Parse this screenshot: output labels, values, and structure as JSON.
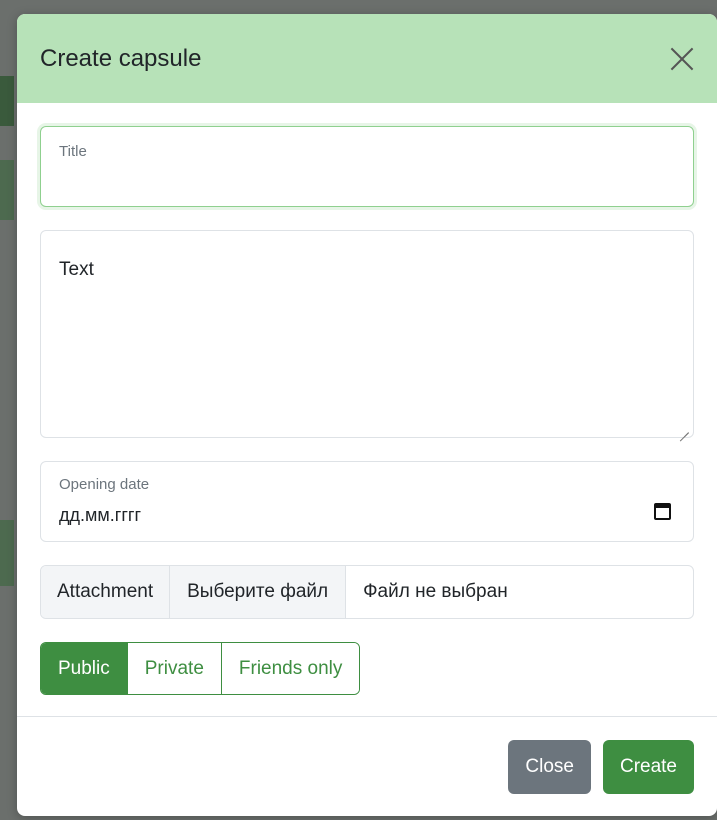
{
  "modal": {
    "title": "Create capsule"
  },
  "form": {
    "title_label": "Title",
    "title_value": "",
    "text_placeholder": "Text",
    "date_label": "Opening date",
    "date_value": "дд.мм.гггг",
    "attachment_label": "Attachment",
    "file_button": "Выберите файл",
    "file_status": "Файл не выбран",
    "visibility": {
      "options": [
        "Public",
        "Private",
        "Friends only"
      ],
      "selected": "Public"
    }
  },
  "footer": {
    "close_label": "Close",
    "create_label": "Create"
  },
  "colors": {
    "header_bg": "#b7e2b8",
    "accent": "#3e8e41",
    "secondary": "#6c757d"
  },
  "icons": {
    "close": "close-icon",
    "calendar": "calendar-icon"
  }
}
